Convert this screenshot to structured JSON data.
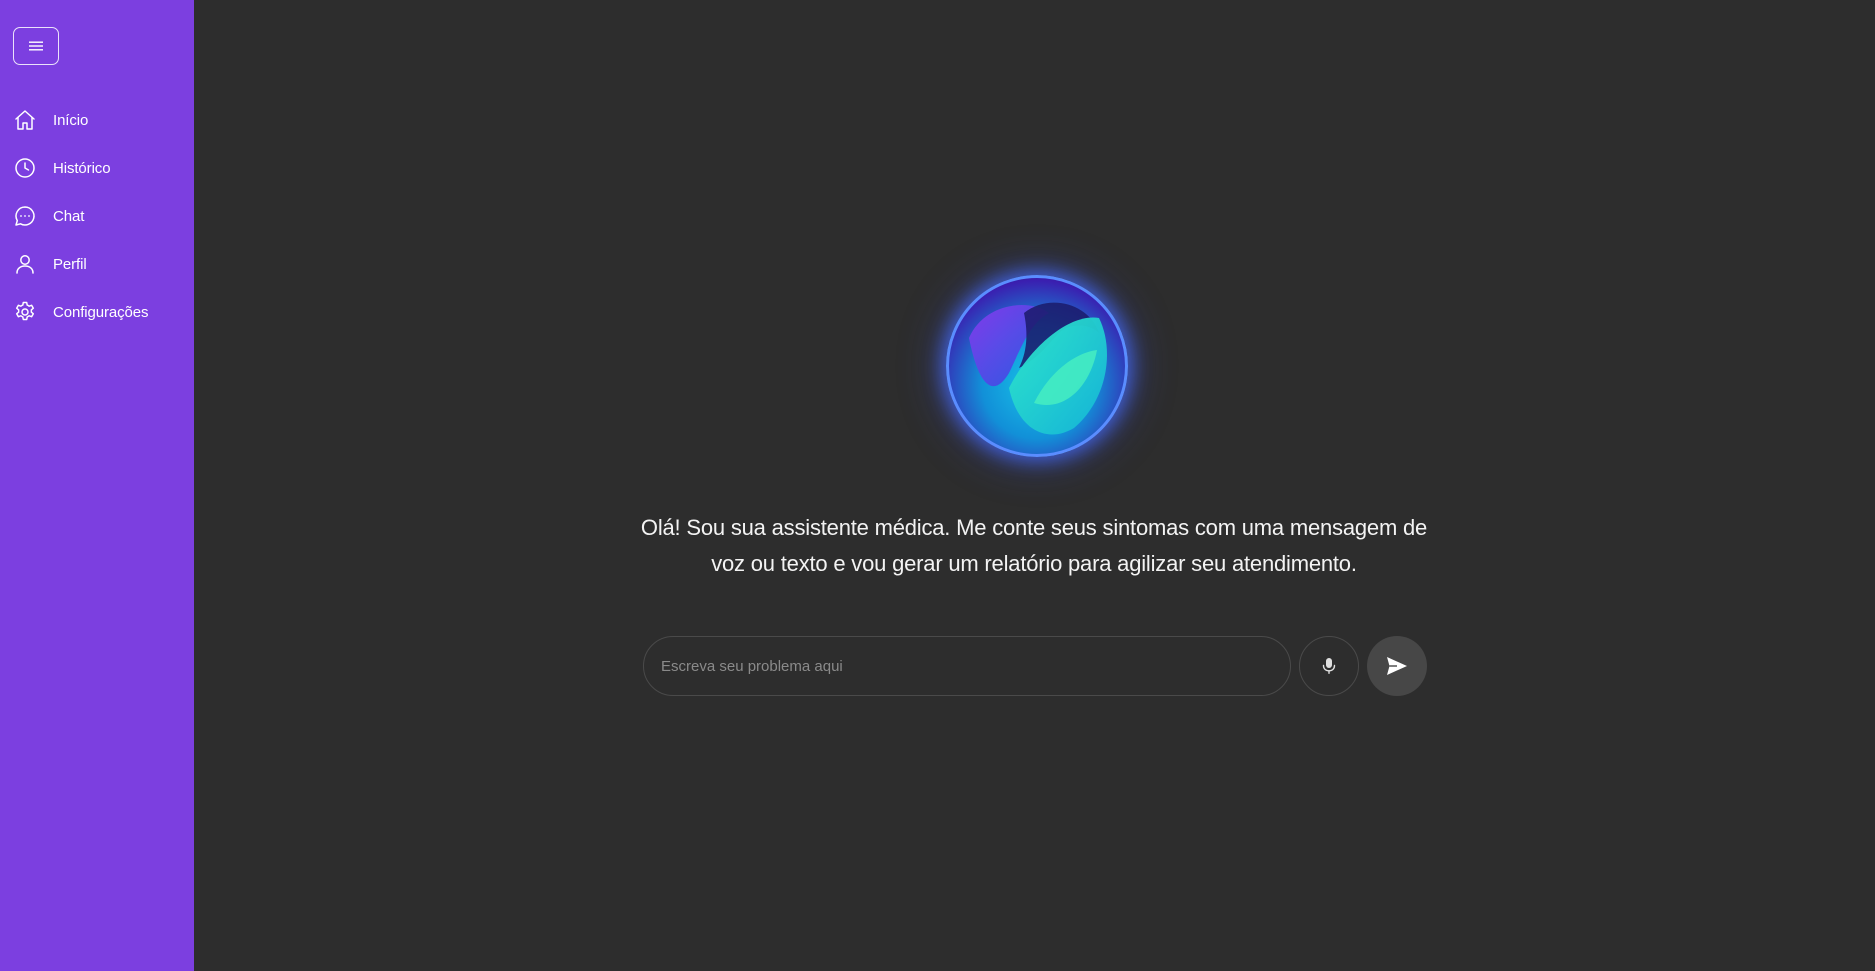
{
  "sidebar": {
    "menu_toggle_icon": "hamburger-menu-icon",
    "items": [
      {
        "label": "Início",
        "icon": "home-icon"
      },
      {
        "label": "Histórico",
        "icon": "clock-icon"
      },
      {
        "label": "Chat",
        "icon": "chat-bubble-icon"
      },
      {
        "label": "Perfil",
        "icon": "user-icon"
      },
      {
        "label": "Configurações",
        "icon": "gear-icon"
      }
    ]
  },
  "main": {
    "assistant_avatar": "assistant-orb-logo",
    "greeting": "Olá! Sou sua assistente médica. Me conte seus sintomas com uma mensagem de voz ou texto e vou gerar um relatório para agilizar seu atendimento.",
    "input": {
      "placeholder": "Escreva seu problema aqui",
      "value": ""
    },
    "mic_icon": "microphone-icon",
    "send_icon": "send-icon"
  },
  "colors": {
    "sidebar_bg": "#7c3fe0",
    "main_bg": "#2d2d2d",
    "text_primary": "#f3f3f3",
    "send_button_bg": "#474747"
  }
}
